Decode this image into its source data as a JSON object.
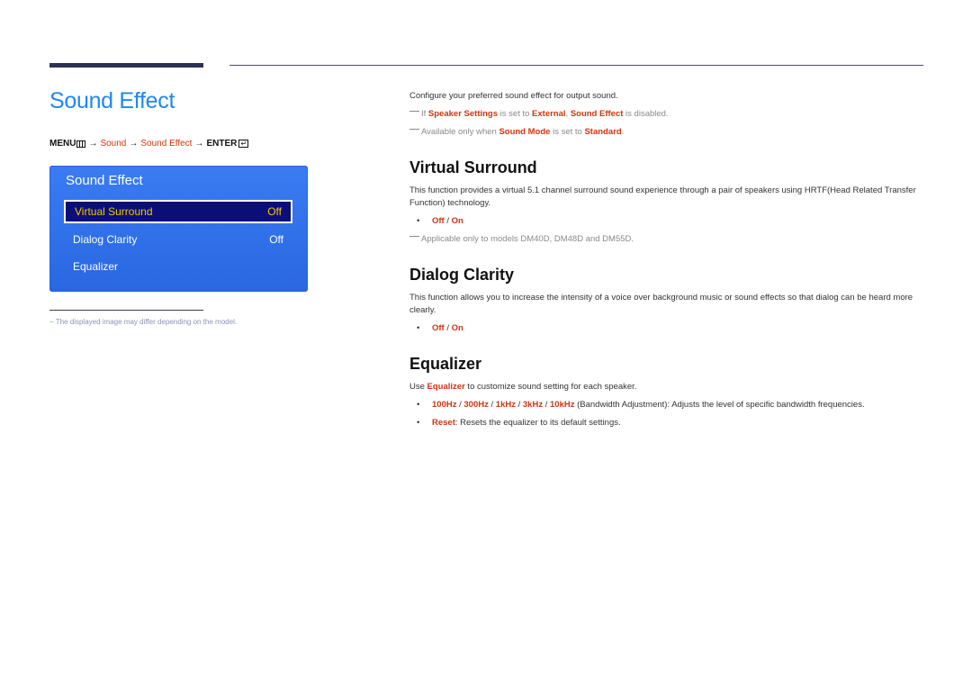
{
  "page": {
    "title": "Sound Effect"
  },
  "menu_path": {
    "menu_label": "MENU",
    "arrow": "→",
    "steps": [
      "Sound",
      "Sound Effect"
    ],
    "enter_label": "ENTER"
  },
  "osd": {
    "title": "Sound Effect",
    "items": [
      {
        "label": "Virtual Surround",
        "value": "Off",
        "selected": true
      },
      {
        "label": "Dialog Clarity",
        "value": "Off",
        "selected": false
      },
      {
        "label": "Equalizer",
        "value": "",
        "selected": false
      }
    ]
  },
  "footnote": "The displayed image may differ depending on the model.",
  "intro": {
    "text": "Configure your preferred sound effect for output sound.",
    "note1": {
      "pre": "If ",
      "k1": "Speaker Settings",
      "mid1": " is set to ",
      "k2": "External",
      "comma": ", ",
      "k3": "Sound Effect",
      "post": " is disabled."
    },
    "note2": {
      "pre": "Available only when ",
      "k1": "Sound Mode",
      "mid": " is set to ",
      "k2": "Standard",
      "post": "."
    }
  },
  "sections": {
    "virtual_surround": {
      "heading": "Virtual Surround",
      "body": "This function provides a virtual 5.1 channel surround sound experience through a pair of speakers using HRTF(Head Related Transfer Function) technology.",
      "opt_off": "Off",
      "opt_sep": " / ",
      "opt_on": "On",
      "note": "Applicable only to models DM40D, DM48D and DM55D."
    },
    "dialog_clarity": {
      "heading": "Dialog Clarity",
      "body": "This function allows you to increase the intensity of a voice over background music or sound effects so that dialog can be heard more clearly.",
      "opt_off": "Off",
      "opt_sep": " / ",
      "opt_on": "On"
    },
    "equalizer": {
      "heading": "Equalizer",
      "body_pre": "Use ",
      "body_key": "Equalizer",
      "body_post": " to customize sound setting for each speaker.",
      "bands": [
        "100Hz",
        "300Hz",
        "1kHz",
        "3kHz",
        "10kHz"
      ],
      "band_sep": " / ",
      "bands_desc": " (Bandwidth Adjustment): Adjusts the level of specific bandwidth frequencies.",
      "reset_key": "Reset",
      "reset_desc": ": Resets the equalizer to its default settings."
    }
  },
  "bullet_char": "•",
  "colors": {
    "title_blue": "#1e88f0",
    "highlight_red": "#d4330f",
    "osd_blue": "#2f6fe8",
    "osd_selected_bg": "#0a0f78",
    "osd_selected_text": "#f5c400"
  }
}
